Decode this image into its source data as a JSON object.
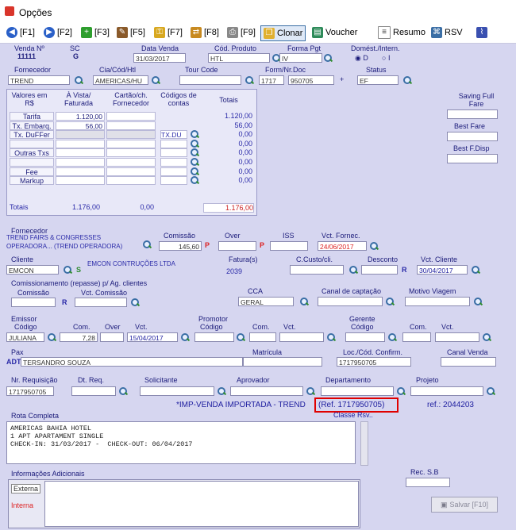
{
  "window": {
    "title": "Opções"
  },
  "toolbar": {
    "f1": "[F1]",
    "f2": "[F2]",
    "f3": "[F3]",
    "f5": "[F5]",
    "f7": "[F7]",
    "f8": "[F8]",
    "f9": "[F9]",
    "clonar": "Clonar",
    "voucher": "Voucher",
    "resumo": "Resumo",
    "rsv": "RSV"
  },
  "header": {
    "venda_lbl": "Venda Nº",
    "venda_val": "11111",
    "sc_lbl": "SC",
    "sc_val": "G",
    "data_venda_lbl": "Data Venda",
    "data_venda_val": "31/03/2017",
    "cod_produto_lbl": "Cód. Produto",
    "cod_produto_val": "HTL",
    "forma_pgt_lbl": "Forma Pgt",
    "forma_pgt_val": "IV",
    "domest_lbl": "Domést./Intern.",
    "domest_d": "D",
    "domest_i": "I",
    "fornecedor_lbl": "Fornecedor",
    "fornecedor_val": "TREND",
    "cia_lbl": "Cia/Cód/Htl",
    "cia_val": "AMERICAS/HU",
    "tour_lbl": "Tour Code",
    "tour_val": "",
    "form_lbl": "Form/Nr.Doc",
    "form_val1": "1717",
    "form_val2": "950705",
    "status_lbl": "Status",
    "status_val": "EF"
  },
  "values_table": {
    "col_valores": "Valores em R$",
    "col_avista": "À Vista/ Faturada",
    "col_cartao": "Cartão/ch. Fornecedor",
    "col_codigos": "Códigos de contas",
    "col_totais": "Totais",
    "rows": [
      {
        "label": "Tarifa",
        "avista": "1.120,00",
        "total": "1.120,00"
      },
      {
        "label": "Tx. Embarq.",
        "avista": "56,00",
        "total": "56,00"
      },
      {
        "label": "Tx. DuFFer",
        "avista": "",
        "total": "0,00"
      },
      {
        "label": "",
        "avista": "",
        "total": "0,00"
      },
      {
        "label": "Outras Txs",
        "avista": "",
        "total": "0,00"
      },
      {
        "label": "",
        "avista": "",
        "total": "0,00"
      },
      {
        "label": "Fee",
        "avista": "",
        "total": "0,00"
      },
      {
        "label": "Markup",
        "avista": "",
        "total": "0,00"
      }
    ],
    "codigo_du": "TX.DU",
    "totais_lbl": "Totais",
    "totais_avista": "1.176,00",
    "totais_cartao": "0,00",
    "totais_geral": "1.176,00"
  },
  "saving": {
    "full_fare_lbl": "Saving Full Fare",
    "best_fare_lbl": "Best Fare",
    "best_disp_lbl": "Best F.Disp"
  },
  "fornecedor2": {
    "lbl": "Fornecedor",
    "linha1": "TREND FAIRS & CONGRESSES",
    "linha2": "OPERADORA... (TREND OPERADORA)",
    "comissao_lbl": "Comissão",
    "comissao_val": "145,60",
    "over_lbl": "Over",
    "iss_lbl": "ISS",
    "vct_fornec_lbl": "Vct. Fornec.",
    "vct_fornec_val": "24/06/2017"
  },
  "cliente": {
    "lbl": "Cliente",
    "codigo": "EMCON",
    "nome": "EMCON CONTRUÇÕES LTDA",
    "faturas_lbl": "Fatura(s)",
    "faturas_val": "2039",
    "ccusto_lbl": "C.Custo/cli.",
    "desconto_lbl": "Desconto",
    "desconto_flag": "R",
    "vct_cliente_lbl": "Vct. Cliente",
    "vct_cliente_val": "30/04/2017"
  },
  "comissionamento": {
    "lbl": "Comissionamento (repasse) p/ Ag. clientes",
    "comissao_lbl": "Comissão",
    "vct_lbl": "Vct. Comissão",
    "cca_lbl": "CCA",
    "cca_val": "GERAL",
    "canal_captacao_lbl": "Canal de captação",
    "motivo_lbl": "Motivo Viagem"
  },
  "emissor": {
    "lbl": "Emissor",
    "codigo_lbl": "Código",
    "codigo_val": "JULIANA",
    "com_lbl": "Com.",
    "com_val": "7,28",
    "over_lbl": "Over",
    "vct_lbl": "Vct.",
    "vct_val": "15/04/2017",
    "promotor_lbl": "Promotor",
    "promotor_cod_lbl": "Código",
    "promotor_com_lbl": "Com.",
    "promotor_vct_lbl": "Vct.",
    "gerente_lbl": "Gerente",
    "gerente_cod_lbl": "Código",
    "gerente_com_lbl": "Com.",
    "gerente_vct_lbl": "Vct."
  },
  "pax": {
    "lbl": "Pax",
    "tipo": "ADT",
    "nome": "TERSANDRO SOUZA",
    "matricula_lbl": "Matrícula",
    "loc_lbl": "Loc./Cód. Confirm.",
    "loc_val": "1717950705",
    "canal_venda_lbl": "Canal Venda"
  },
  "requisicao": {
    "nr_lbl": "Nr. Requisição",
    "nr_val": "1717950705",
    "dt_lbl": "Dt. Req.",
    "solicitante_lbl": "Solicitante",
    "aprovador_lbl": "Aprovador",
    "departamento_lbl": "Departamento",
    "projeto_lbl": "Projeto"
  },
  "import_line": {
    "text": "*IMP-VENDA IMPORTADA - TREND",
    "ref_box": "(Ref. 1717950705)",
    "ref_label": "ref.: 2044203",
    "classe": "Classe Rsv.."
  },
  "rota": {
    "lbl": "Rota Completa",
    "text": "AMERICAS BAHIA HOTEL\n1 APT APARTAMENT SINGLE\nCHECK-IN: 31/03/2017 -  CHECK-OUT: 06/04/2017"
  },
  "info": {
    "lbl": "Informações Adicionais",
    "externa": "Externa",
    "interna": "Interna",
    "rec_lbl": "Rec. S.B",
    "salvar": "Salvar [F10]"
  }
}
